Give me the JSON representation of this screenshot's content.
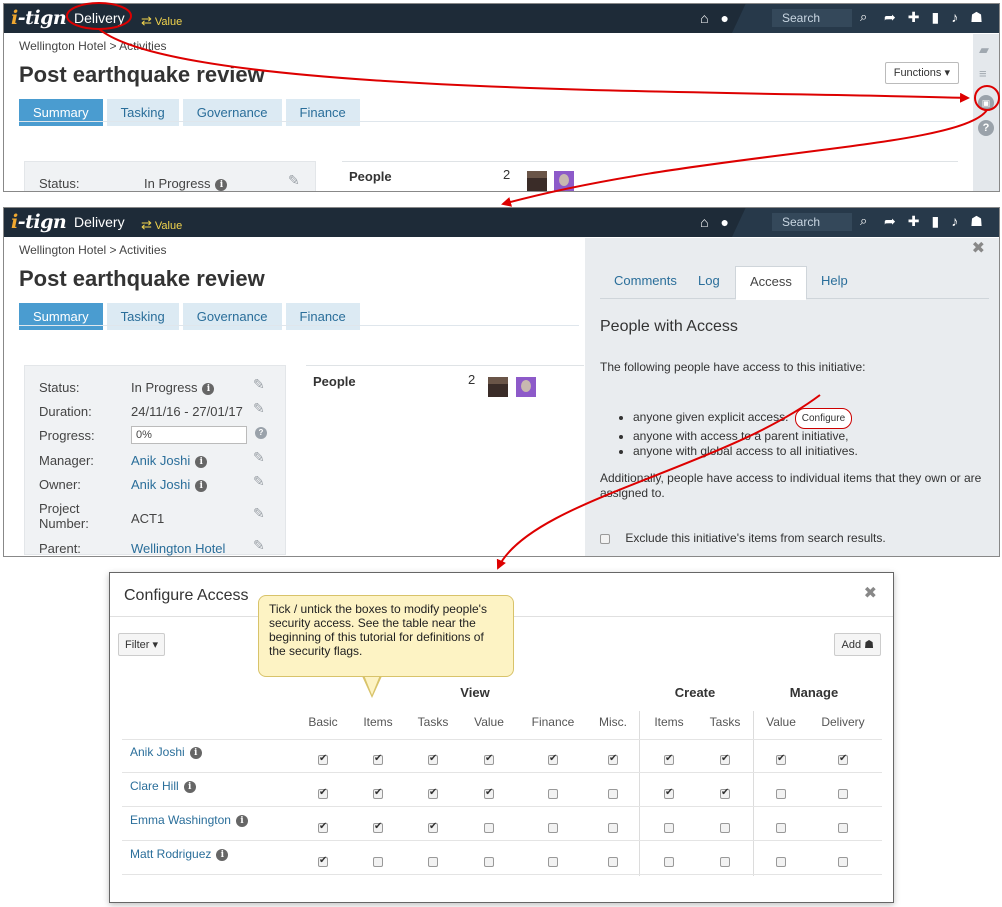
{
  "app": {
    "logo_text": "i-tign",
    "delivery_label": "Delivery",
    "value_label": "Value",
    "search_placeholder": "Search"
  },
  "page": {
    "breadcrumb": "Wellington Hotel > Activities",
    "title": "Post earthquake review",
    "functions_label": "Functions ▾",
    "tabs": [
      "Summary",
      "Tasking",
      "Governance",
      "Finance"
    ]
  },
  "details": {
    "status_label": "Status:",
    "status_value": "In Progress",
    "duration_label": "Duration:",
    "duration_value": "24/11/16 - 27/01/17",
    "progress_label": "Progress:",
    "progress_value": "0%",
    "manager_label": "Manager:",
    "manager_value": "Anik Joshi",
    "owner_label": "Owner:",
    "owner_value": "Anik Joshi",
    "project_number_label": "Project Number:",
    "project_number_value": "ACT1",
    "parent_label": "Parent:",
    "parent_value": "Wellington Hotel"
  },
  "people": {
    "label": "People",
    "count": "2"
  },
  "side_panel": {
    "tabs": [
      "Comments",
      "Log",
      "Access",
      "Help"
    ],
    "heading": "People with Access",
    "intro": "The following people have access to this initiative:",
    "bullet1": "anyone given explicit access.",
    "configure_label": "Configure",
    "bullet2": "anyone with access to a parent initiative,",
    "bullet3": "anyone with global access to all initiatives.",
    "additional": "Additionally, people have access to individual items that they own or are assigned to.",
    "exclude_label": "Exclude this initiative's items from search results."
  },
  "modal": {
    "title": "Configure Access",
    "filter_label": "Filter ▾",
    "add_label": "Add",
    "tooltip": "Tick / untick the boxes to modify people's security access. See the table near the beginning of this tutorial for definitions of the security flags.",
    "groups": [
      "View",
      "Create",
      "Manage"
    ],
    "columns": [
      "Basic",
      "Items",
      "Tasks",
      "Value",
      "Finance",
      "Misc.",
      "Items",
      "Tasks",
      "Value",
      "Delivery"
    ],
    "rows": [
      {
        "name": "Anik Joshi",
        "flags": [
          true,
          true,
          true,
          true,
          true,
          true,
          true,
          true,
          true,
          true
        ]
      },
      {
        "name": "Clare Hill",
        "flags": [
          true,
          true,
          true,
          true,
          false,
          false,
          true,
          true,
          false,
          false
        ]
      },
      {
        "name": "Emma Washington",
        "flags": [
          true,
          true,
          true,
          false,
          false,
          false,
          false,
          false,
          false,
          false
        ]
      },
      {
        "name": "Matt Rodriguez",
        "flags": [
          true,
          false,
          false,
          false,
          false,
          false,
          false,
          false,
          false,
          false
        ]
      }
    ]
  },
  "colors": {
    "topbar": "#1e2b38",
    "accent": "#4a9cd0",
    "link": "#2a6e9a",
    "annotation": "#dd0000"
  }
}
